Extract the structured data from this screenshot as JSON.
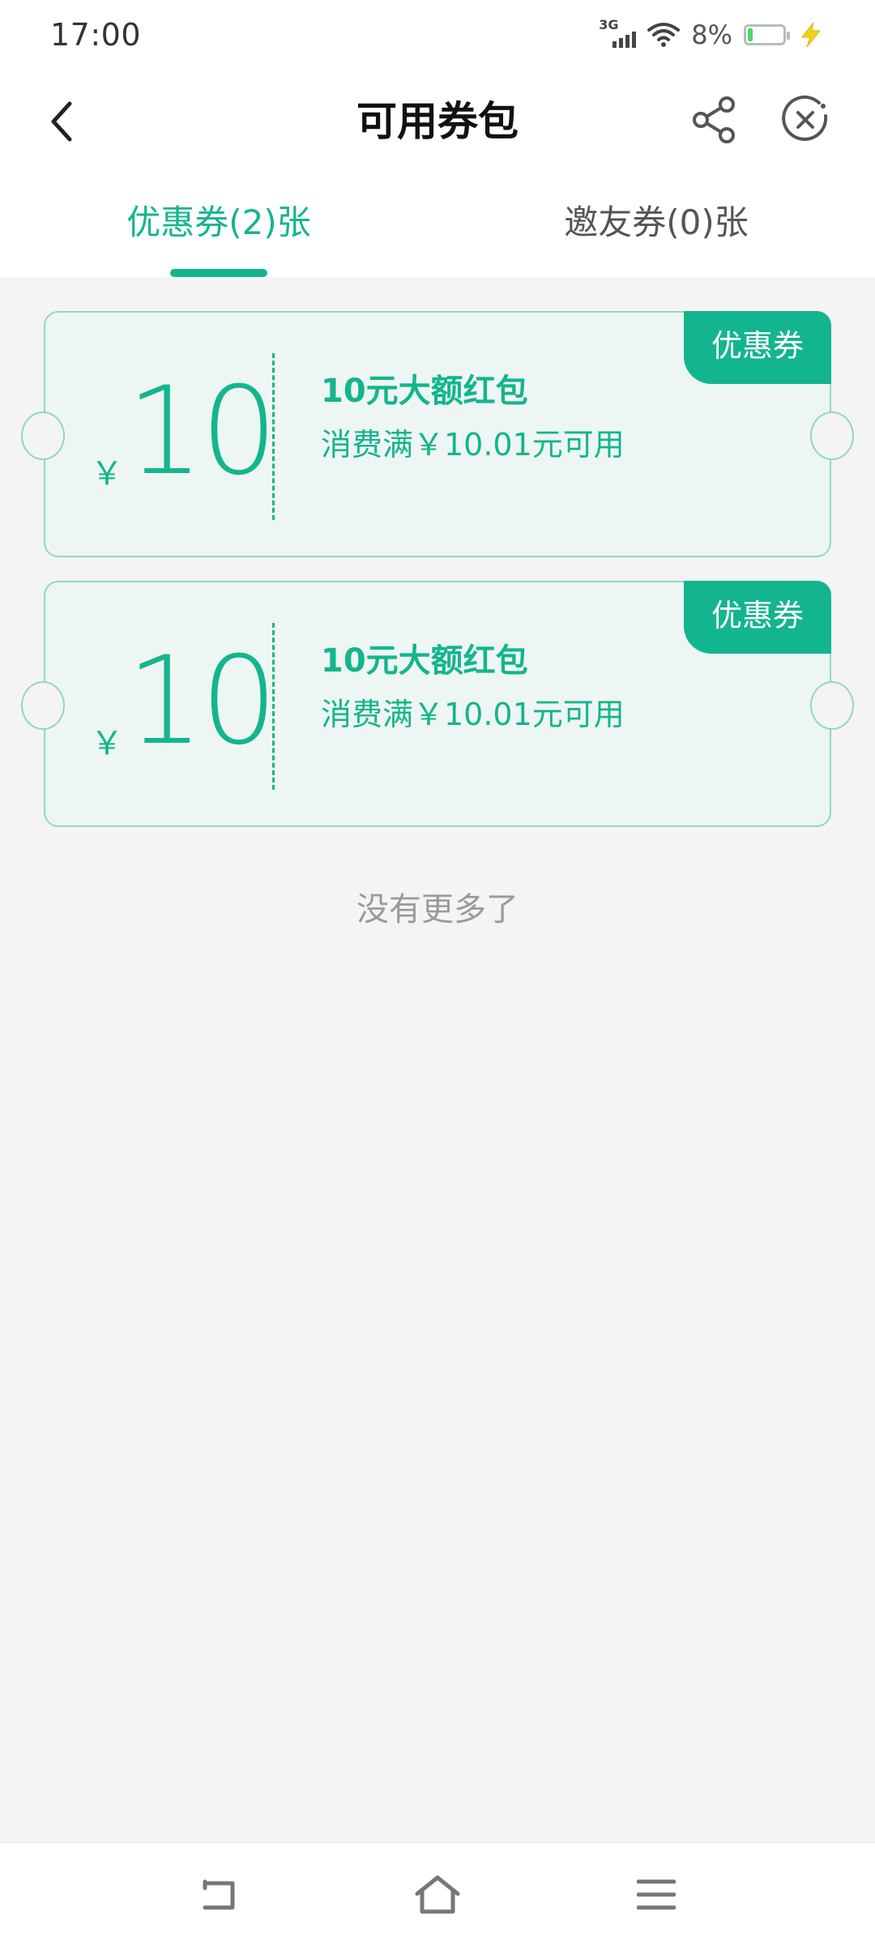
{
  "status_bar": {
    "time": "17:00",
    "network": "3G",
    "battery_percent": "8%",
    "icons": [
      "signal-icon",
      "wifi-icon",
      "battery-icon",
      "charging-icon"
    ]
  },
  "header": {
    "title": "可用券包",
    "icons": [
      "back-icon",
      "share-icon",
      "close-icon"
    ]
  },
  "tabs": [
    {
      "label": "优惠券(2)张",
      "active": true
    },
    {
      "label": "邀友券(0)张",
      "active": false
    }
  ],
  "coupons": [
    {
      "badge": "优惠券",
      "currency": "￥",
      "amount": "10",
      "title": "10元大额红包",
      "condition": "消费满￥10.01元可用"
    },
    {
      "badge": "优惠券",
      "currency": "￥",
      "amount": "10",
      "title": "10元大额红包",
      "condition": "消费满￥10.01元可用"
    }
  ],
  "footer_text": "没有更多了",
  "colors": {
    "accent": "#13b58e",
    "coupon_bg": "#eef6f3",
    "coupon_border": "#8fd8c4",
    "page_bg": "#f4f4f4"
  },
  "nav_bar": {
    "icons": [
      "nav-back-icon",
      "nav-home-icon",
      "nav-menu-icon"
    ]
  }
}
